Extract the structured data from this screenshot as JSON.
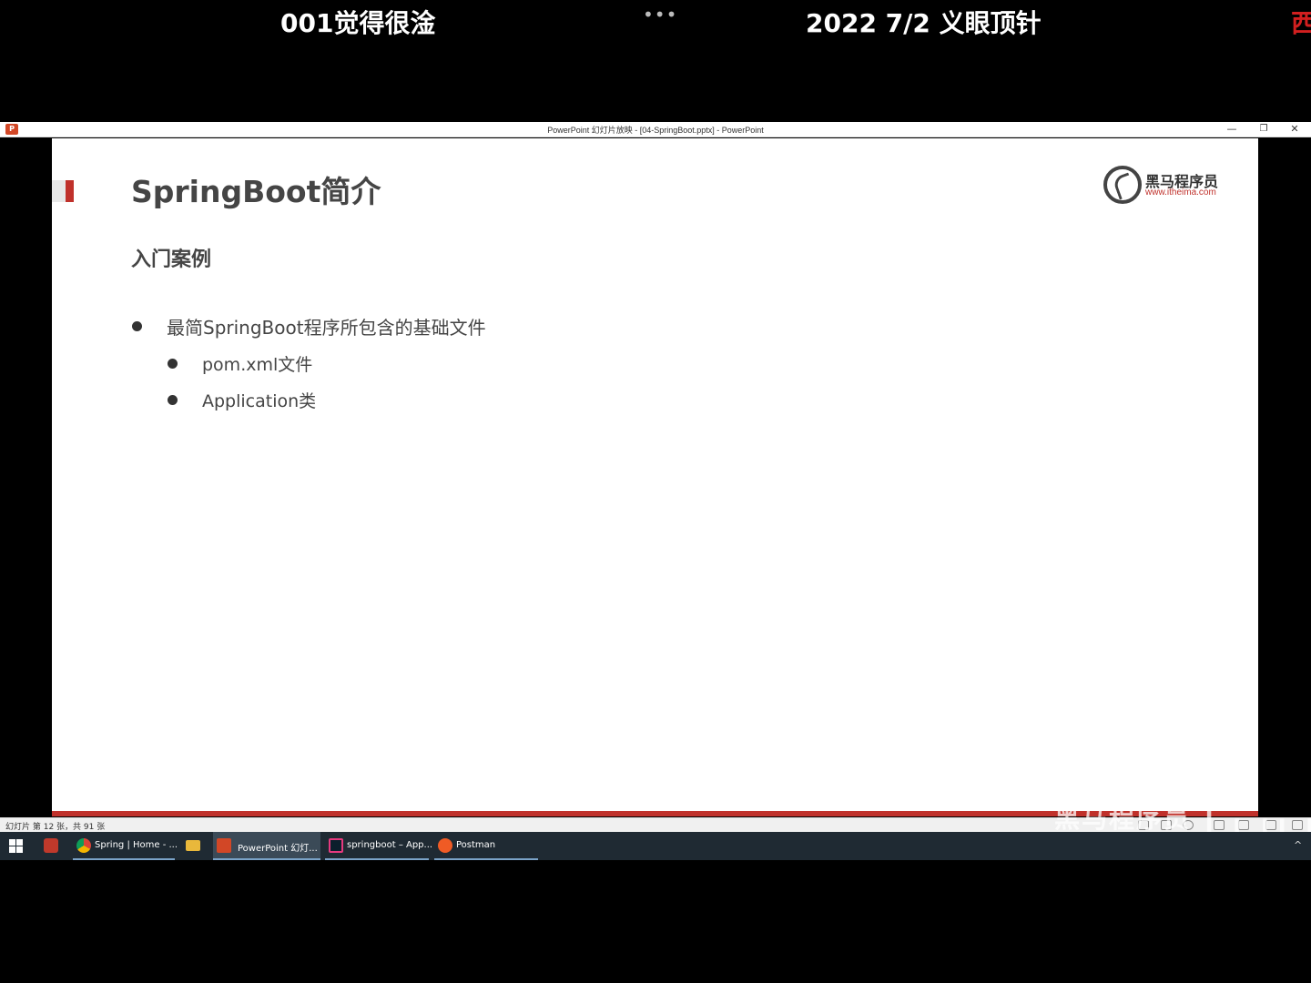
{
  "overlay": {
    "left_text": "001觉得很淦",
    "dots": "•••",
    "right_text": "2022 7/2 义眼顶针",
    "edge_text": "西"
  },
  "window": {
    "title": "PowerPoint 幻灯片放映 - [04-SpringBoot.pptx] - PowerPoint",
    "app_icon_glyph": "P",
    "minimize_glyph": "—",
    "restore_glyph": "❐",
    "close_glyph": "✕"
  },
  "slide": {
    "title": "SpringBoot简介",
    "subtitle": "入门案例",
    "bullets": [
      "最简SpringBoot程序所包含的基础文件",
      "pom.xml文件",
      "Application类"
    ],
    "logo": {
      "cn": "黑马程序员",
      "url": "www.itheima.com"
    },
    "accent_color": "#c0312b"
  },
  "statusbar": {
    "text": "幻灯片 第 12 张，共 91 张",
    "watermark": "黑马程序员 ┃ ╻ ╻╻ ╻╹"
  },
  "taskbar": {
    "items": [
      {
        "label": "Spring | Home - ...",
        "icon": "chrome-icon"
      },
      {
        "label": "",
        "icon": "file-explorer-icon"
      },
      {
        "label": "PowerPoint 幻灯...",
        "icon": "powerpoint-icon"
      },
      {
        "label": "springboot – App...",
        "icon": "intellij-icon"
      },
      {
        "label": "Postman",
        "icon": "postman-icon"
      }
    ],
    "chevron": "^"
  }
}
